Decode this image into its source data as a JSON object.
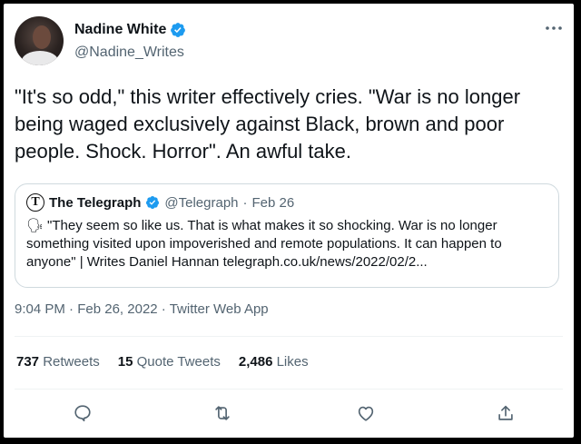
{
  "author": {
    "display_name": "Nadine White",
    "handle": "@Nadine_Writes"
  },
  "more_icon": "more-horizontal-icon",
  "tweet": {
    "text": "\"It's so odd,\" this writer effectively cries. \"War is no longer being waged exclusively against Black, brown and poor people. Shock. Horror\". An awful take."
  },
  "quote": {
    "display_name": "The Telegraph",
    "logo_letter": "T",
    "handle": "@Telegraph",
    "separator": "·",
    "date": "Feb 26",
    "emoji": "🗣",
    "text": "\"They seem so like us. That is what makes it so shocking. War is no longer something visited upon impoverished and remote populations. It can happen to anyone\" | Writes Daniel Hannan telegraph.co.uk/news/2022/02/2..."
  },
  "meta": {
    "time": "9:04 PM",
    "sep1": "·",
    "date": "Feb 26, 2022",
    "sep2": "·",
    "source": "Twitter Web App"
  },
  "stats": {
    "retweets_count": "737",
    "retweets_label": "Retweets",
    "quotes_count": "15",
    "quotes_label": "Quote Tweets",
    "likes_count": "2,486",
    "likes_label": "Likes"
  },
  "colors": {
    "verified": "#1d9bf0",
    "secondary_text": "#536471",
    "border": "#cfd9de"
  },
  "actions": [
    "reply-icon",
    "retweet-icon",
    "like-icon",
    "share-icon"
  ]
}
